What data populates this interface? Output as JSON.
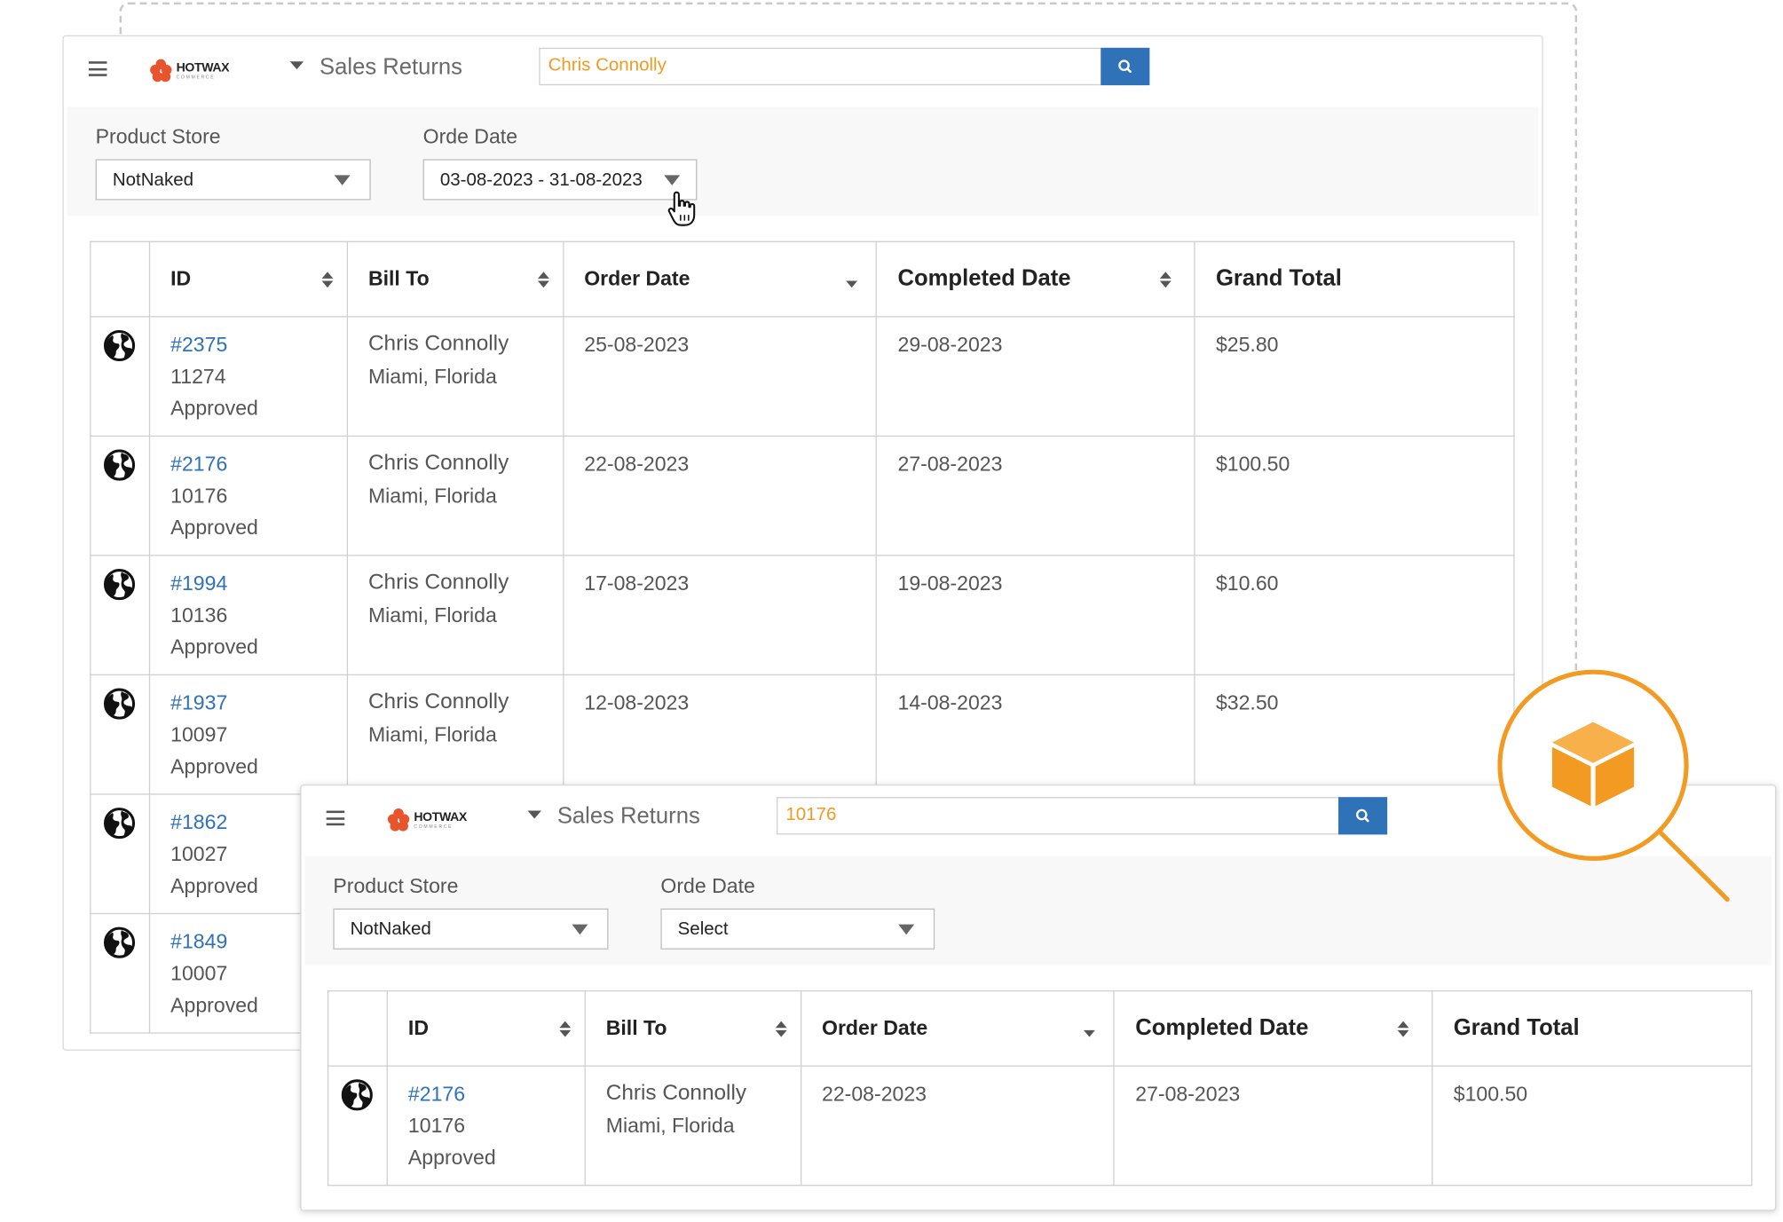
{
  "colors": {
    "accent": "#f29a22",
    "link": "#2f72b8",
    "search_button": "#2f72b8",
    "border": "#cfcfcf",
    "filter_bg": "#f8f8f8"
  },
  "back_window": {
    "header": {
      "logo_word": "HOTWAX",
      "logo_sub": "COMMERCE",
      "title": "Sales Returns",
      "search_value": "Chris Connolly"
    },
    "filters": {
      "product_store_label": "Product Store",
      "product_store_value": "NotNaked",
      "order_date_label": "Orde Date",
      "order_date_value": "03-08-2023 - 31-08-2023"
    },
    "table": {
      "columns": [
        "ID",
        "Bill To",
        "Order Date",
        "Completed Date",
        "Grand Total"
      ],
      "rows": [
        {
          "id": "#2375",
          "number": "11274",
          "status": "Approved",
          "bill_name": "Chris Connolly",
          "bill_location": "Miami, Florida",
          "order_date": "25-08-2023",
          "completed_date": "29-08-2023",
          "total": "$25.80"
        },
        {
          "id": "#2176",
          "number": "10176",
          "status": "Approved",
          "bill_name": "Chris Connolly",
          "bill_location": "Miami, Florida",
          "order_date": "22-08-2023",
          "completed_date": "27-08-2023",
          "total": "$100.50"
        },
        {
          "id": "#1994",
          "number": "10136",
          "status": "Approved",
          "bill_name": "Chris Connolly",
          "bill_location": "Miami, Florida",
          "order_date": "17-08-2023",
          "completed_date": "19-08-2023",
          "total": "$10.60"
        },
        {
          "id": "#1937",
          "number": "10097",
          "status": "Approved",
          "bill_name": "Chris Connolly",
          "bill_location": "Miami, Florida",
          "order_date": "12-08-2023",
          "completed_date": "14-08-2023",
          "total": "$32.50"
        },
        {
          "id": "#1862",
          "number": "10027",
          "status": "Approved",
          "bill_name": "",
          "bill_location": "",
          "order_date": "",
          "completed_date": "",
          "total": ""
        },
        {
          "id": "#1849",
          "number": "10007",
          "status": "Approved",
          "bill_name": "",
          "bill_location": "",
          "order_date": "",
          "completed_date": "",
          "total": ""
        }
      ]
    }
  },
  "front_window": {
    "header": {
      "logo_word": "HOTWAX",
      "logo_sub": "COMMERCE",
      "title": "Sales Returns",
      "search_value": "10176"
    },
    "filters": {
      "product_store_label": "Product Store",
      "product_store_value": "NotNaked",
      "order_date_label": "Orde Date",
      "order_date_value": "Select"
    },
    "table": {
      "columns": [
        "ID",
        "Bill To",
        "Order Date",
        "Completed Date",
        "Grand Total"
      ],
      "rows": [
        {
          "id": "#2176",
          "number": "10176",
          "status": "Approved",
          "bill_name": "Chris Connolly",
          "bill_location": "Miami, Florida",
          "order_date": "22-08-2023",
          "completed_date": "27-08-2023",
          "total": "$100.50"
        }
      ]
    }
  },
  "icons": {
    "menu": "hamburger-icon",
    "search": "magnifier-icon",
    "row": "globe-icon",
    "sort": "sort-icon",
    "pointer": "hand-pointer-icon",
    "product": "package-box-icon",
    "zoom": "magnifying-glass-icon"
  }
}
